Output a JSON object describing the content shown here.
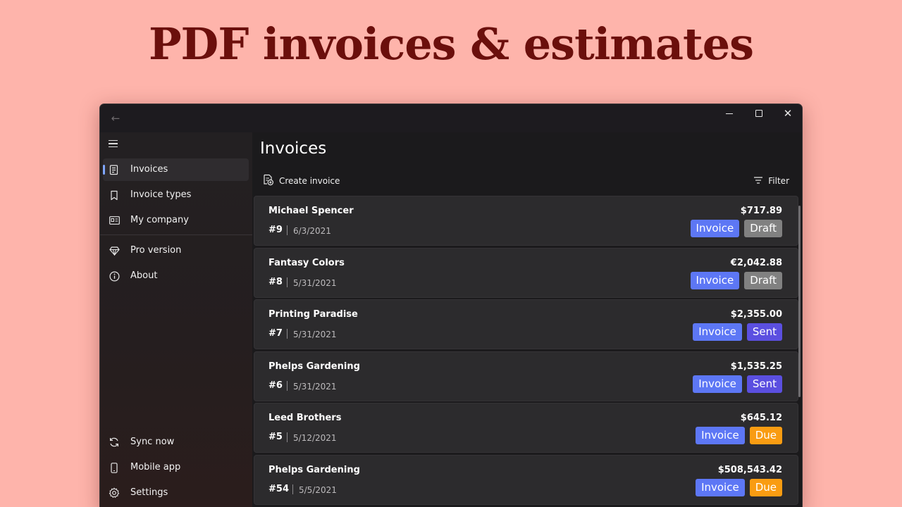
{
  "hero": {
    "title": "PDF invoices & estimates"
  },
  "window": {
    "back_icon": "arrow-left-icon",
    "controls": [
      "minimize-icon",
      "maximize-icon",
      "close-icon"
    ]
  },
  "sidebar": {
    "menu_icon": "hamburger-icon",
    "items": [
      {
        "label": "Invoices",
        "icon": "receipt-icon",
        "active": true
      },
      {
        "label": "Invoice types",
        "icon": "bookmark-icon"
      },
      {
        "label": "My company",
        "icon": "id-card-icon"
      },
      {
        "label": "Pro version",
        "icon": "diamond-icon"
      },
      {
        "label": "About",
        "icon": "info-icon"
      }
    ],
    "footer_items": [
      {
        "label": "Sync now",
        "icon": "sync-icon"
      },
      {
        "label": "Mobile app",
        "icon": "phone-icon"
      },
      {
        "label": "Settings",
        "icon": "gear-icon"
      }
    ]
  },
  "main": {
    "title": "Invoices",
    "toolbar": {
      "create_label": "Create invoice",
      "filter_label": "Filter"
    },
    "invoices": [
      {
        "name": "Michael Spencer",
        "number": "#9",
        "date": "6/3/2021",
        "amount": "$717.89",
        "type": "Invoice",
        "status": "Draft"
      },
      {
        "name": "Fantasy Colors",
        "number": "#8",
        "date": "5/31/2021",
        "amount": "€2,042.88",
        "type": "Invoice",
        "status": "Draft"
      },
      {
        "name": "Printing Paradise",
        "number": "#7",
        "date": "5/31/2021",
        "amount": "$2,355.00",
        "type": "Invoice",
        "status": "Sent"
      },
      {
        "name": "Phelps Gardening",
        "number": "#6",
        "date": "5/31/2021",
        "amount": "$1,535.25",
        "type": "Invoice",
        "status": "Sent"
      },
      {
        "name": "Leed Brothers",
        "number": "#5",
        "date": "5/12/2021",
        "amount": "$645.12",
        "type": "Invoice",
        "status": "Due"
      },
      {
        "name": "Phelps Gardening",
        "number": "#54",
        "date": "5/5/2021",
        "amount": "$508,543.42",
        "type": "Invoice",
        "status": "Due"
      }
    ]
  },
  "colors": {
    "background": "#feb4ab",
    "hero_text": "#6b0f0c",
    "accent": "#7fa6ff",
    "badge_type": "#5d77f5",
    "badge_draft": "#818181",
    "badge_sent": "#5b4fe0",
    "badge_due": "#f99c12"
  }
}
